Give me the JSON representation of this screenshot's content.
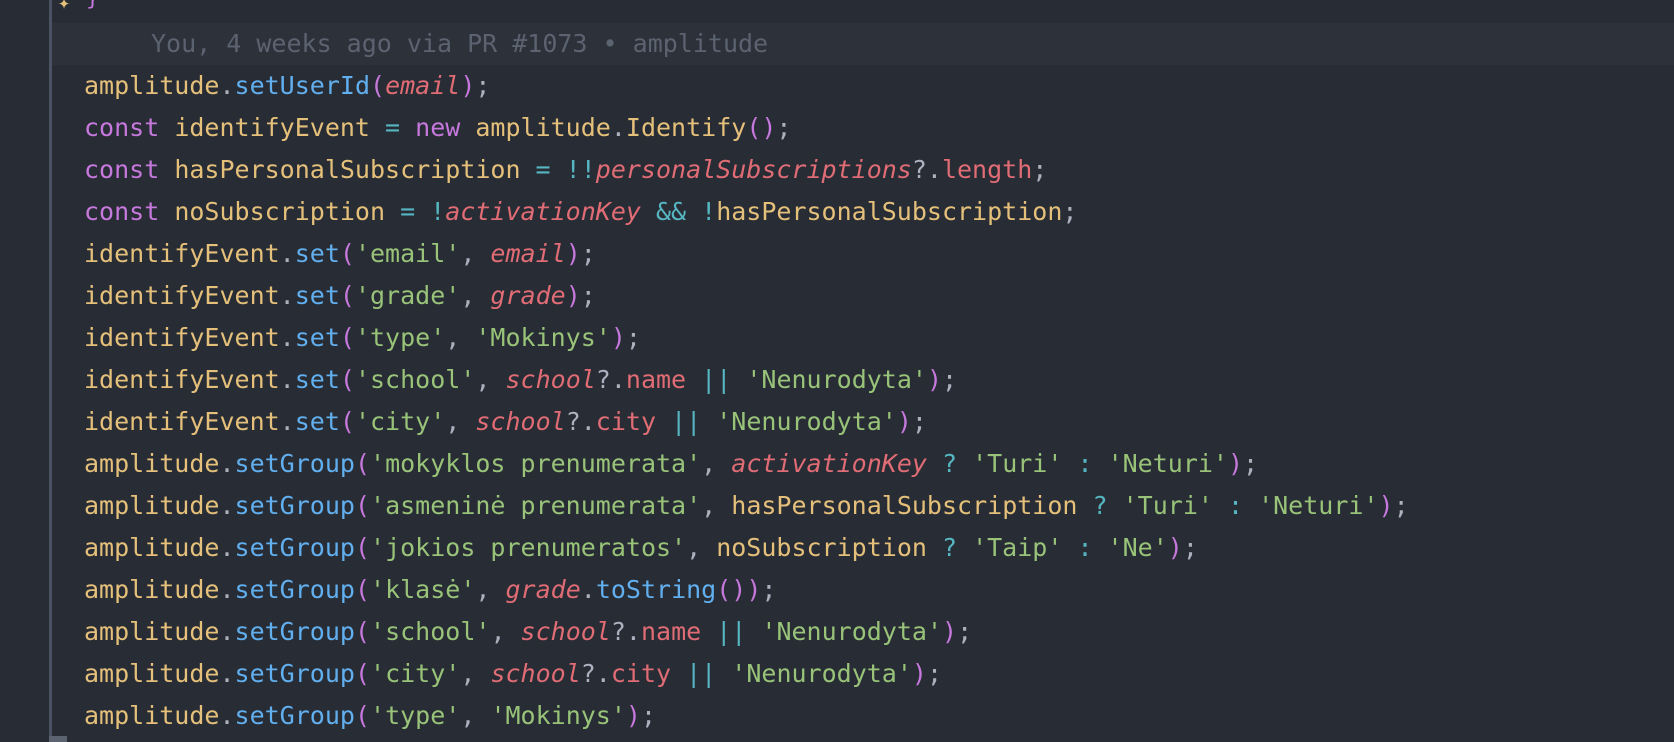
{
  "editor": {
    "prev_line_brace": "}",
    "blame": "You, 4 weeks ago via PR #1073 • amplitude",
    "lines": [
      [
        [
          "obj",
          "amplitude"
        ],
        [
          "pl",
          "."
        ],
        [
          "fn",
          "setUserId"
        ],
        [
          "par",
          "("
        ],
        [
          "id",
          "email"
        ],
        [
          "par",
          ")"
        ],
        [
          "pl",
          ";"
        ]
      ],
      [
        [
          "kw",
          "const "
        ],
        [
          "var",
          "identifyEvent"
        ],
        [
          "op",
          " = "
        ],
        [
          "kw",
          "new "
        ],
        [
          "obj",
          "amplitude"
        ],
        [
          "pl",
          "."
        ],
        [
          "obj",
          "Identify"
        ],
        [
          "par",
          "()"
        ],
        [
          "pl",
          ";"
        ]
      ],
      [
        [
          "kw",
          "const "
        ],
        [
          "var",
          "hasPersonalSubscription"
        ],
        [
          "op",
          " = !!"
        ],
        [
          "id",
          "personalSubscriptions"
        ],
        [
          "pl",
          "?."
        ],
        [
          "prop",
          "length"
        ],
        [
          "pl",
          ";"
        ]
      ],
      [
        [
          "kw",
          "const "
        ],
        [
          "var",
          "noSubscription"
        ],
        [
          "op",
          " = !"
        ],
        [
          "id",
          "activationKey"
        ],
        [
          "op",
          " && !"
        ],
        [
          "var",
          "hasPersonalSubscription"
        ],
        [
          "pl",
          ";"
        ]
      ],
      [
        [
          "var",
          "identifyEvent"
        ],
        [
          "pl",
          "."
        ],
        [
          "fn",
          "set"
        ],
        [
          "par",
          "("
        ],
        [
          "str",
          "'email'"
        ],
        [
          "pl",
          ", "
        ],
        [
          "id",
          "email"
        ],
        [
          "par",
          ")"
        ],
        [
          "pl",
          ";"
        ]
      ],
      [
        [
          "var",
          "identifyEvent"
        ],
        [
          "pl",
          "."
        ],
        [
          "fn",
          "set"
        ],
        [
          "par",
          "("
        ],
        [
          "str",
          "'grade'"
        ],
        [
          "pl",
          ", "
        ],
        [
          "id",
          "grade"
        ],
        [
          "par",
          ")"
        ],
        [
          "pl",
          ";"
        ]
      ],
      [
        [
          "var",
          "identifyEvent"
        ],
        [
          "pl",
          "."
        ],
        [
          "fn",
          "set"
        ],
        [
          "par",
          "("
        ],
        [
          "str",
          "'type'"
        ],
        [
          "pl",
          ", "
        ],
        [
          "str",
          "'Mokinys'"
        ],
        [
          "par",
          ")"
        ],
        [
          "pl",
          ";"
        ]
      ],
      [
        [
          "var",
          "identifyEvent"
        ],
        [
          "pl",
          "."
        ],
        [
          "fn",
          "set"
        ],
        [
          "par",
          "("
        ],
        [
          "str",
          "'school'"
        ],
        [
          "pl",
          ", "
        ],
        [
          "id",
          "school"
        ],
        [
          "pl",
          "?."
        ],
        [
          "prop",
          "name"
        ],
        [
          "op",
          " || "
        ],
        [
          "str",
          "'Nenurodyta'"
        ],
        [
          "par",
          ")"
        ],
        [
          "pl",
          ";"
        ]
      ],
      [
        [
          "var",
          "identifyEvent"
        ],
        [
          "pl",
          "."
        ],
        [
          "fn",
          "set"
        ],
        [
          "par",
          "("
        ],
        [
          "str",
          "'city'"
        ],
        [
          "pl",
          ", "
        ],
        [
          "id",
          "school"
        ],
        [
          "pl",
          "?."
        ],
        [
          "prop",
          "city"
        ],
        [
          "op",
          " || "
        ],
        [
          "str",
          "'Nenurodyta'"
        ],
        [
          "par",
          ")"
        ],
        [
          "pl",
          ";"
        ]
      ],
      [
        [
          "obj",
          "amplitude"
        ],
        [
          "pl",
          "."
        ],
        [
          "fn",
          "setGroup"
        ],
        [
          "par",
          "("
        ],
        [
          "str",
          "'mokyklos prenumerata'"
        ],
        [
          "pl",
          ", "
        ],
        [
          "id",
          "activationKey"
        ],
        [
          "op",
          " ? "
        ],
        [
          "str",
          "'Turi'"
        ],
        [
          "op",
          " : "
        ],
        [
          "str",
          "'Neturi'"
        ],
        [
          "par",
          ")"
        ],
        [
          "pl",
          ";"
        ]
      ],
      [
        [
          "obj",
          "amplitude"
        ],
        [
          "pl",
          "."
        ],
        [
          "fn",
          "setGroup"
        ],
        [
          "par",
          "("
        ],
        [
          "str",
          "'asmeninė prenumerata'"
        ],
        [
          "pl",
          ", "
        ],
        [
          "var",
          "hasPersonalSubscription"
        ],
        [
          "op",
          " ? "
        ],
        [
          "str",
          "'Turi'"
        ],
        [
          "op",
          " : "
        ],
        [
          "str",
          "'Neturi'"
        ],
        [
          "par",
          ")"
        ],
        [
          "pl",
          ";"
        ]
      ],
      [
        [
          "obj",
          "amplitude"
        ],
        [
          "pl",
          "."
        ],
        [
          "fn",
          "setGroup"
        ],
        [
          "par",
          "("
        ],
        [
          "str",
          "'jokios prenumeratos'"
        ],
        [
          "pl",
          ", "
        ],
        [
          "var",
          "noSubscription"
        ],
        [
          "op",
          " ? "
        ],
        [
          "str",
          "'Taip'"
        ],
        [
          "op",
          " : "
        ],
        [
          "str",
          "'Ne'"
        ],
        [
          "par",
          ")"
        ],
        [
          "pl",
          ";"
        ]
      ],
      [
        [
          "obj",
          "amplitude"
        ],
        [
          "pl",
          "."
        ],
        [
          "fn",
          "setGroup"
        ],
        [
          "par",
          "("
        ],
        [
          "str",
          "'klasė'"
        ],
        [
          "pl",
          ", "
        ],
        [
          "id",
          "grade"
        ],
        [
          "pl",
          "."
        ],
        [
          "fn",
          "toString"
        ],
        [
          "par",
          "())"
        ],
        [
          "pl",
          ";"
        ]
      ],
      [
        [
          "obj",
          "amplitude"
        ],
        [
          "pl",
          "."
        ],
        [
          "fn",
          "setGroup"
        ],
        [
          "par",
          "("
        ],
        [
          "str",
          "'school'"
        ],
        [
          "pl",
          ", "
        ],
        [
          "id",
          "school"
        ],
        [
          "pl",
          "?."
        ],
        [
          "prop",
          "name"
        ],
        [
          "op",
          " || "
        ],
        [
          "str",
          "'Nenurodyta'"
        ],
        [
          "par",
          ")"
        ],
        [
          "pl",
          ";"
        ]
      ],
      [
        [
          "obj",
          "amplitude"
        ],
        [
          "pl",
          "."
        ],
        [
          "fn",
          "setGroup"
        ],
        [
          "par",
          "("
        ],
        [
          "str",
          "'city'"
        ],
        [
          "pl",
          ", "
        ],
        [
          "id",
          "school"
        ],
        [
          "pl",
          "?."
        ],
        [
          "prop",
          "city"
        ],
        [
          "op",
          " || "
        ],
        [
          "str",
          "'Nenurodyta'"
        ],
        [
          "par",
          ")"
        ],
        [
          "pl",
          ";"
        ]
      ],
      [
        [
          "obj",
          "amplitude"
        ],
        [
          "pl",
          "."
        ],
        [
          "fn",
          "setGroup"
        ],
        [
          "par",
          "("
        ],
        [
          "str",
          "'type'"
        ],
        [
          "pl",
          ", "
        ],
        [
          "str",
          "'Mokinys'"
        ],
        [
          "par",
          ")"
        ],
        [
          "pl",
          ";"
        ]
      ]
    ]
  },
  "colors": {
    "background": "#282c34",
    "keyword": "#c678dd",
    "function": "#61afef",
    "string": "#98c379",
    "variable": "#e5c07b",
    "parameter": "#e06c75",
    "comment": "#5c6370"
  },
  "icons": {
    "gutter_marker": "sparkle-icon"
  }
}
